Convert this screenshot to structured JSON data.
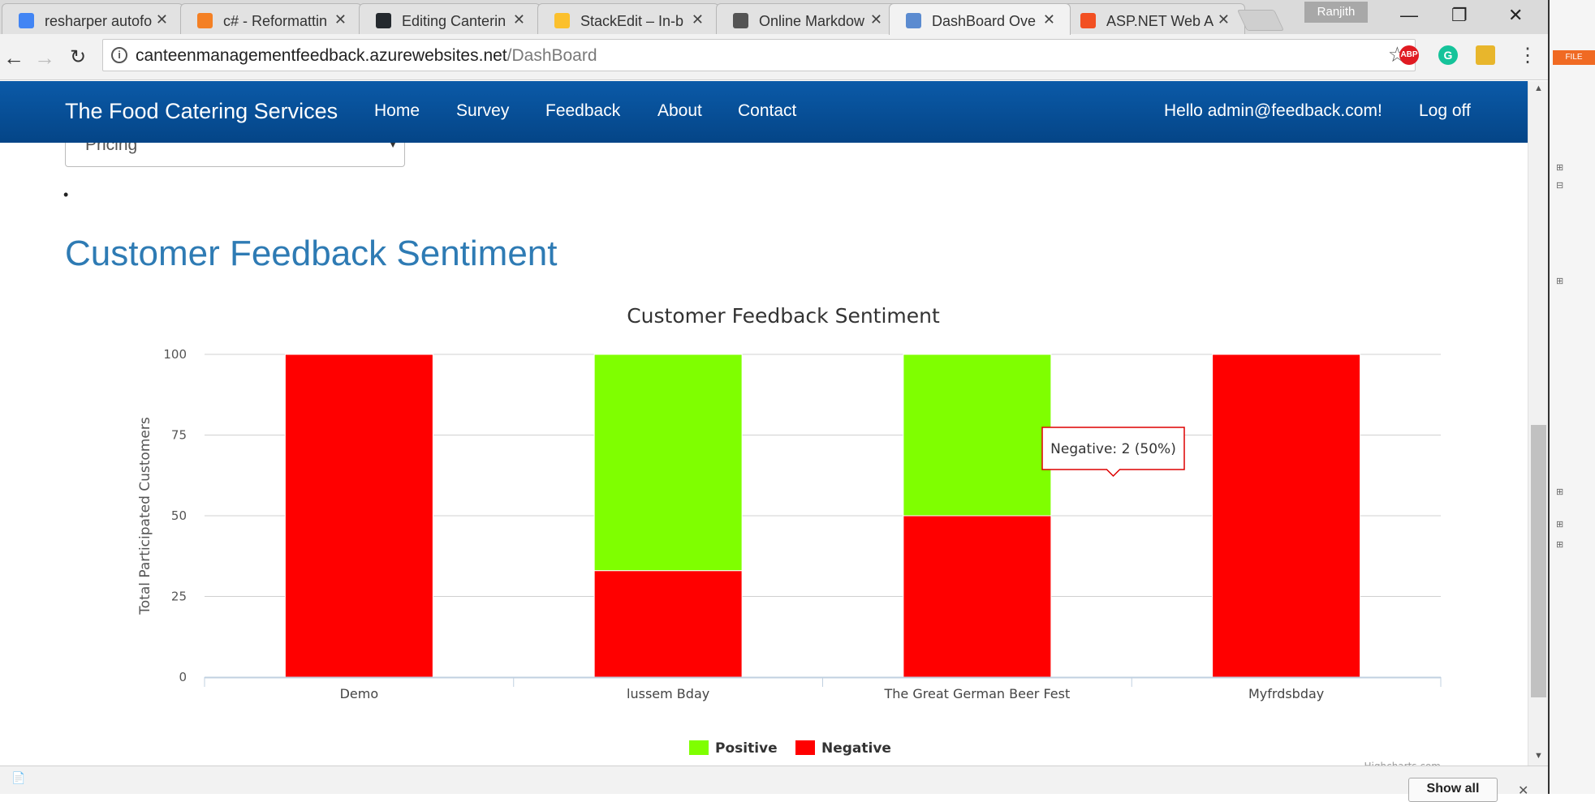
{
  "browser": {
    "tabs": [
      {
        "title": "resharper autofo",
        "icon_color": "#4285f4",
        "icon": "google-icon"
      },
      {
        "title": "c# - Reformattin",
        "icon_color": "#f48024",
        "icon": "stackoverflow-icon"
      },
      {
        "title": "Editing Canterin",
        "icon_color": "#24292e",
        "icon": "github-icon"
      },
      {
        "title": "StackEdit – In-b",
        "icon_color": "#fbc02d",
        "icon": "stackedit-icon"
      },
      {
        "title": "Online Markdow",
        "icon_color": "#555555",
        "icon": "dillinger-icon"
      },
      {
        "title": "DashBoard Ove",
        "icon_color": "#5b8bd0",
        "icon": "page-icon"
      },
      {
        "title": "ASP.NET Web A",
        "icon_color": "#f25022",
        "icon": "microsoft-icon"
      }
    ],
    "profile_name": "Ranjith",
    "url_host": "canteenmanagementfeedback.azurewebsites.net",
    "url_path": "/DashBoard",
    "extensions": [
      {
        "label": "ABP",
        "color": "#e01b22"
      },
      {
        "label": "G",
        "color": "#15c39a"
      }
    ]
  },
  "site": {
    "brand": "The Food Catering Services",
    "nav": [
      "Home",
      "Survey",
      "Feedback",
      "About",
      "Contact"
    ],
    "greeting": "Hello admin@feedback.com!",
    "logoff": "Log off"
  },
  "page": {
    "select_value": "Pricing",
    "heading": "Customer Feedback Sentiment"
  },
  "chart_data": {
    "type": "bar",
    "stacked": true,
    "title": "Customer Feedback Sentiment",
    "xlabel": "",
    "ylabel": "Total Participated Customers",
    "ylim": [
      0,
      100
    ],
    "yticks": [
      0,
      25,
      50,
      75,
      100
    ],
    "categories": [
      "Demo",
      "lussem Bday",
      "The Great German Beer Fest",
      "Myfrdsbday"
    ],
    "series": [
      {
        "name": "Positive",
        "color": "#7fff00",
        "values": [
          0,
          67,
          50,
          0
        ]
      },
      {
        "name": "Negative",
        "color": "#ff0000",
        "values": [
          100,
          33,
          50,
          100
        ]
      }
    ],
    "legend": "bottom-center",
    "grid": true,
    "tooltip": {
      "text": "Negative: 2 (50%)"
    },
    "credits": "Highcharts.com"
  },
  "download_bar": {
    "show_all": "Show all"
  }
}
